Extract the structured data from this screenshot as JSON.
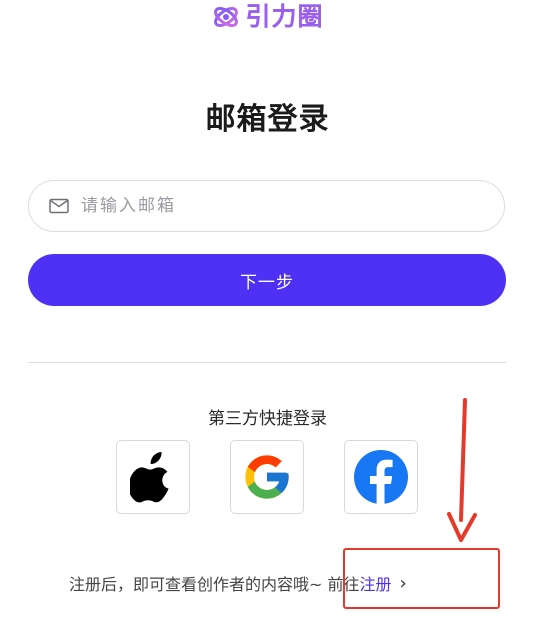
{
  "brand": {
    "name": "引力圈",
    "color": "#9b5ff0"
  },
  "page": {
    "title": "邮箱登录"
  },
  "email": {
    "placeholder": "请输入邮箱",
    "icon": "mail-icon"
  },
  "next_button": {
    "label": "下一步",
    "color": "#4f31f5"
  },
  "third_party": {
    "title": "第三方快捷登录",
    "providers": [
      {
        "name": "Apple",
        "icon": "apple-icon"
      },
      {
        "name": "Google",
        "icon": "google-icon"
      },
      {
        "name": "Facebook",
        "icon": "facebook-icon"
      }
    ]
  },
  "footer": {
    "text": "注册后，即可查看创作者的内容哦~ 前往",
    "link": "注册",
    "chevron": "›"
  },
  "annotation": {
    "color": "#e53a2b"
  }
}
